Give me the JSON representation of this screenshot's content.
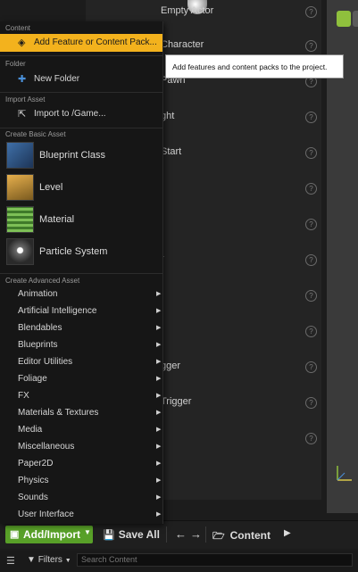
{
  "place_actors": {
    "items": [
      {
        "label": "Empty Actor"
      },
      {
        "label": "Character"
      },
      {
        "label": "Pawn"
      },
      {
        "label": "ght"
      },
      {
        "label": "Start"
      },
      {
        "label": ""
      },
      {
        "label": ""
      },
      {
        "label": "r"
      },
      {
        "label": ""
      },
      {
        "label": ""
      },
      {
        "label": "gger"
      },
      {
        "label": "Trigger"
      },
      {
        "label": ""
      }
    ],
    "info_glyph": "?"
  },
  "menu": {
    "content_header": "Content",
    "add_feature_label": "Add Feature or Content Pack...",
    "folder_header": "Folder",
    "new_folder_label": "New Folder",
    "import_header": "Import Asset",
    "import_label": "Import to /Game...",
    "basic_header": "Create Basic Asset",
    "basic_items": [
      {
        "label": "Blueprint Class",
        "icon": "blueprint-class-icon"
      },
      {
        "label": "Level",
        "icon": "level-icon"
      },
      {
        "label": "Material",
        "icon": "material-icon"
      },
      {
        "label": "Particle System",
        "icon": "particle-system-icon"
      }
    ],
    "advanced_header": "Create Advanced Asset",
    "advanced_items": [
      {
        "label": "Animation"
      },
      {
        "label": "Artificial Intelligence"
      },
      {
        "label": "Blendables"
      },
      {
        "label": "Blueprints"
      },
      {
        "label": "Editor Utilities"
      },
      {
        "label": "Foliage"
      },
      {
        "label": "FX"
      },
      {
        "label": "Materials & Textures"
      },
      {
        "label": "Media"
      },
      {
        "label": "Miscellaneous"
      },
      {
        "label": "Paper2D"
      },
      {
        "label": "Physics"
      },
      {
        "label": "Sounds"
      },
      {
        "label": "User Interface"
      }
    ]
  },
  "tooltip": {
    "text": "Add features and content packs to the project."
  },
  "toolbar": {
    "add_import_label": "Add/Import",
    "save_all_label": "Save All",
    "breadcrumb_label": "Content"
  },
  "filterbar": {
    "filters_label": "Filters",
    "search_placeholder": "Search Content"
  },
  "colors": {
    "accent_highlight": "#f3b21d",
    "add_import_green": "#58a028",
    "viewport_button_green": "#8fc03d"
  }
}
